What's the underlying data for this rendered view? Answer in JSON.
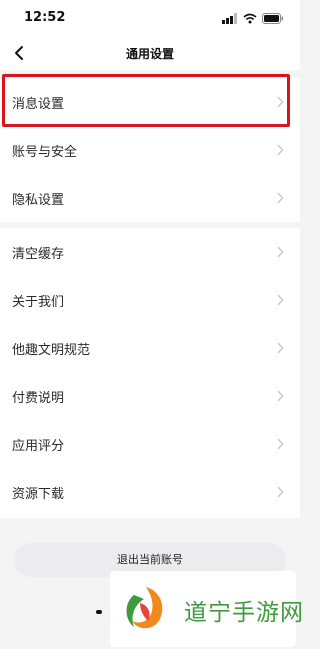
{
  "status_bar": {
    "time": "12:52"
  },
  "nav": {
    "title": "通用设置",
    "back_icon": "chevron-left-icon"
  },
  "groups": [
    {
      "items": [
        {
          "label": "消息设置"
        },
        {
          "label": "账号与安全"
        },
        {
          "label": "隐私设置"
        }
      ]
    },
    {
      "items": [
        {
          "label": "清空缓存"
        },
        {
          "label": "关于我们"
        },
        {
          "label": "他趣文明规范"
        },
        {
          "label": "付费说明"
        },
        {
          "label": "应用评分"
        },
        {
          "label": "资源下载"
        }
      ]
    }
  ],
  "logout": {
    "label": "退出当前账号"
  },
  "watermark": {
    "text": "道宁手游网"
  },
  "colors": {
    "highlight": "#d9161f",
    "background": "#f4f4f5",
    "watermark_green": "#3e9a3c"
  }
}
